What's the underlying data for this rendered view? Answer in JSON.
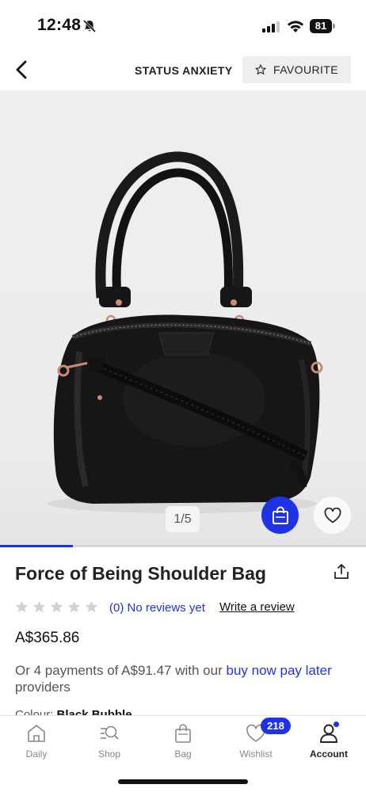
{
  "status_bar": {
    "time": "12:48",
    "battery": "81",
    "icons": [
      "bell-slash-icon",
      "cellular-signal-icon",
      "wifi-icon",
      "battery-icon"
    ]
  },
  "header": {
    "back_icon": "chevron-left-icon",
    "brand": "STATUS ANXIETY",
    "favourite_label": "FAVOURITE",
    "favourite_icon": "star-outline-icon"
  },
  "gallery": {
    "pager": "1/5",
    "progress": 0.2,
    "add_to_bag_icon": "shopping-bag-icon",
    "wishlist_icon": "heart-outline-icon"
  },
  "product": {
    "title": "Force of Being Shoulder Bag",
    "rating_stars": 5,
    "reviews_text": "(0) No reviews yet",
    "write_review": "Write a review",
    "price": "A$365.86",
    "payments_prefix": "Or 4 payments of A$91.47 with our ",
    "payments_link": "buy now pay later",
    "payments_suffix": " providers",
    "colour_label": "Colour: ",
    "colour_value": "Black Bubble"
  },
  "tabbar": {
    "tabs": [
      {
        "label": "Daily",
        "icon": "home-icon"
      },
      {
        "label": "Shop",
        "icon": "search-list-icon"
      },
      {
        "label": "Bag",
        "icon": "bag-icon"
      },
      {
        "label": "Wishlist",
        "icon": "heart-icon"
      },
      {
        "label": "Account",
        "icon": "user-icon"
      }
    ],
    "wishlist_count": "218",
    "active": "Account"
  },
  "colors": {
    "accent": "#1f33e6",
    "muted_text": "#555555",
    "background": "#ffffff"
  }
}
